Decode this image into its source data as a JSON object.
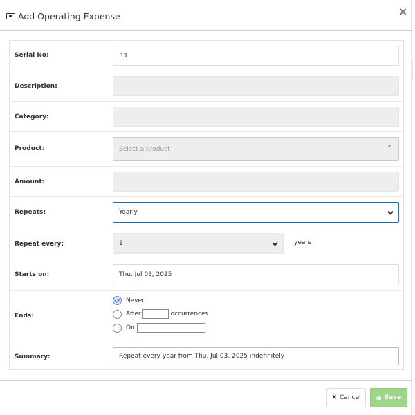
{
  "modal": {
    "title": "Add Operating Expense",
    "close_icon": "×"
  },
  "form": {
    "serial": {
      "label": "Serial No:",
      "value": "33"
    },
    "description": {
      "label": "Description:",
      "value": ""
    },
    "category": {
      "label": "Category:",
      "value": ""
    },
    "product": {
      "label": "Product:",
      "placeholder": "Select a product"
    },
    "amount": {
      "label": "Amount:",
      "value": ""
    },
    "repeats": {
      "label": "Repeats:",
      "value": "Yearly"
    },
    "repeat_every": {
      "label": "Repeat every:",
      "value": "1",
      "unit": "years"
    },
    "starts_on": {
      "label": "Starts on:",
      "value": "Thu. Jul 03, 2025"
    },
    "ends": {
      "label": "Ends:",
      "never_label": "Never",
      "after_label": "After",
      "occurrences_label": "occurrences",
      "on_label": "On",
      "selected": "Never"
    },
    "summary": {
      "label": "Summary:",
      "value": "Repeat every year from Thu. Jul 03, 2025 indefinitely"
    }
  },
  "footer": {
    "cancel_label": "Cancel",
    "save_label": "Save"
  }
}
